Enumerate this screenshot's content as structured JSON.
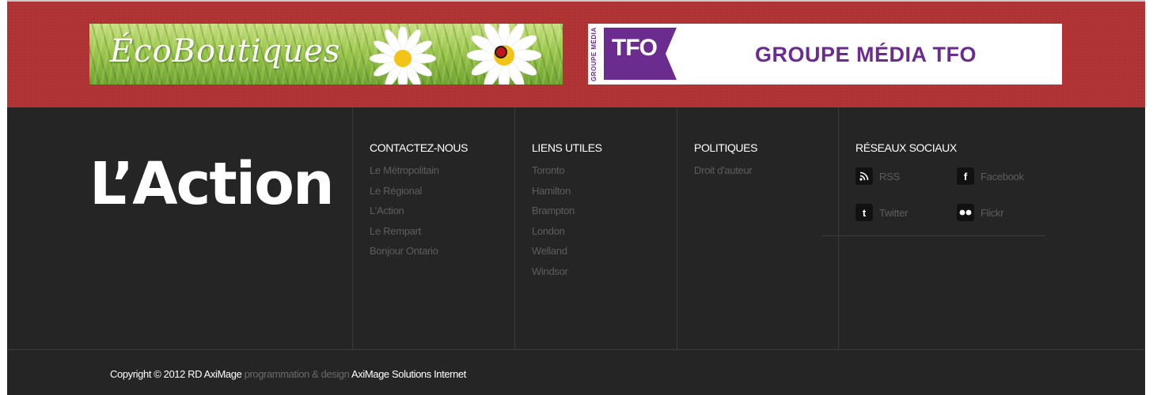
{
  "banner": {
    "ads": [
      {
        "title": "ÉcoBoutiques"
      },
      {
        "side_text": "GROUPE MÉDIA",
        "logo_text": "TFO",
        "title": "GROUPE MÉDIA TFO"
      }
    ]
  },
  "footer": {
    "brand": "L’Action",
    "columns": [
      {
        "heading": "CONTACTEZ-NOUS",
        "links": [
          "Le Métropolitain",
          "Le Régional",
          "L'Action",
          "Le Rempart",
          "Bonjour Ontario"
        ]
      },
      {
        "heading": "LIENS UTILES",
        "links": [
          "Toronto",
          "Hamilton",
          "Brampton",
          "London",
          "Welland",
          "Windsor"
        ]
      },
      {
        "heading": "POLITIQUES",
        "links": [
          "Droit d'auteur"
        ]
      }
    ],
    "social": {
      "heading": "RÉSEAUX SOCIAUX",
      "items": [
        {
          "label": "RSS",
          "icon": "rss-icon"
        },
        {
          "label": "Facebook",
          "icon": "facebook-icon"
        },
        {
          "label": "Twitter",
          "icon": "twitter-icon"
        },
        {
          "label": "Flickr",
          "icon": "flickr-icon"
        }
      ]
    },
    "copyright": {
      "text": "Copyright © 2012 RD AxiMage",
      "credit_prefix": "programmation & design",
      "credit_link": "AxiMage Solutions Internet"
    }
  },
  "colors": {
    "banner_bg": "#b23536",
    "footer_bg": "#252525",
    "tfo_purple": "#6b2c8f",
    "muted_link": "#5d5d5d"
  }
}
